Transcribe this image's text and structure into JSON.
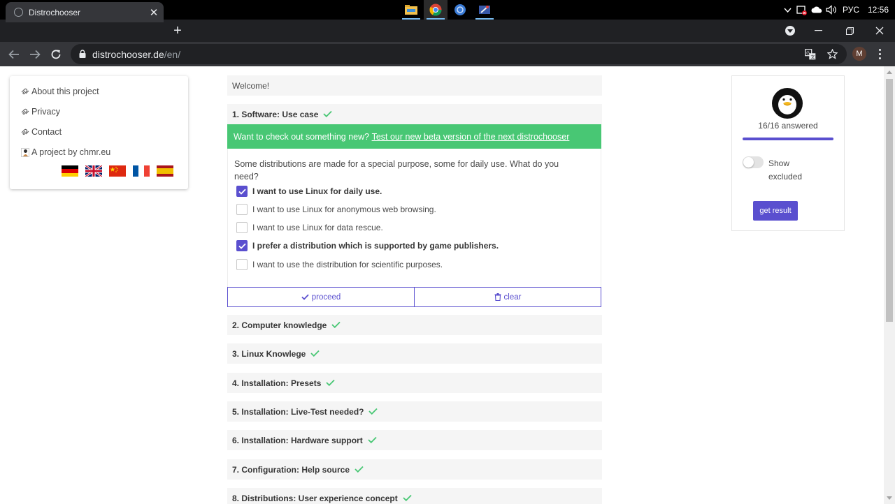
{
  "taskbar": {
    "tray_language": "РУС",
    "clock": "12:56"
  },
  "browser": {
    "tab_title": "Distrochooser",
    "url_host": "distrochooser.de",
    "url_path": "/en/",
    "profile_initial": "M"
  },
  "sidebar": {
    "links": [
      {
        "label": "About this project"
      },
      {
        "label": "Privacy"
      },
      {
        "label": "Contact"
      },
      {
        "label": "A project by chmr.eu"
      }
    ],
    "flags": [
      "germany",
      "united-kingdom",
      "china",
      "france",
      "spain"
    ]
  },
  "main": {
    "welcome": "Welcome!",
    "current_step": "1. Software: Use case",
    "beta_text": "Want to check out something new?",
    "beta_link": "Test our new beta version of the next distrochooser",
    "question": "Some distributions are made for a special purpose, some for daily use. What do you need?",
    "options": [
      {
        "label": "I want to use Linux for daily use.",
        "checked": true
      },
      {
        "label": "I want to use Linux for anonymous web browsing.",
        "checked": false
      },
      {
        "label": "I want to use Linux for data rescue.",
        "checked": false
      },
      {
        "label": "I prefer a distribution which is supported by game publishers.",
        "checked": true
      },
      {
        "label": "I want to use the distribution for scientific purposes.",
        "checked": false
      }
    ],
    "proceed_label": "proceed",
    "clear_label": "clear",
    "steps": [
      "2. Computer knowledge",
      "3. Linux Knowlege",
      "4. Installation: Presets",
      "5. Installation: Live-Test needed?",
      "6. Installation: Hardware support",
      "7. Configuration: Help source",
      "8. Distributions: User experience concept"
    ]
  },
  "result_panel": {
    "answered": "16/16 answered",
    "progress": 1.0,
    "show_excluded_label": "Show excluded",
    "show_excluded_on": false,
    "get_result_label": "get result"
  },
  "colors": {
    "accent": "#5a4fcf",
    "success": "#48c774"
  }
}
